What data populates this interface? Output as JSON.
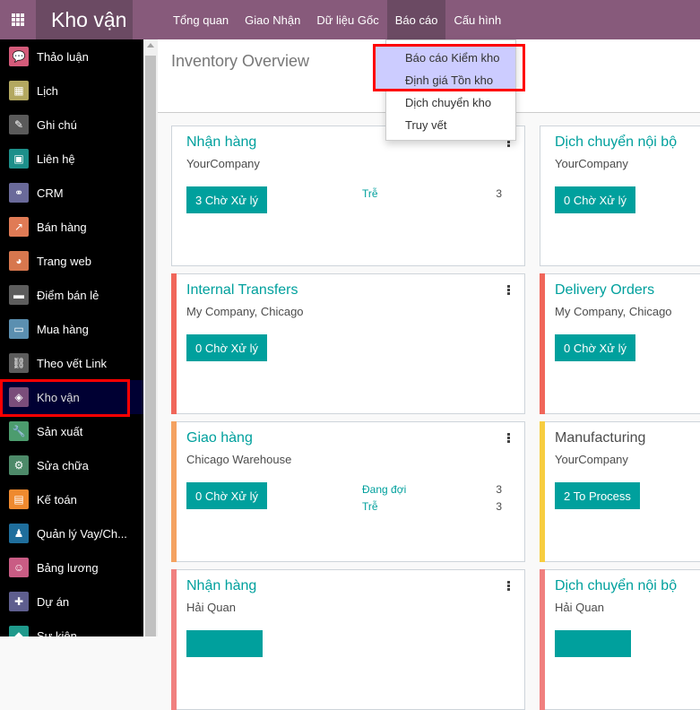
{
  "topbar": {
    "app_name": "Kho vận",
    "menu": [
      "Tổng quan",
      "Giao Nhận",
      "Dữ liệu Gốc",
      "Báo cáo",
      "Cấu hình"
    ],
    "active_menu": "Báo cáo"
  },
  "sidebar": {
    "items": [
      {
        "label": "Thảo luận",
        "icon": "chat-icon",
        "color": "#d45b7a",
        "glyph": "💬"
      },
      {
        "label": "Lịch",
        "icon": "calendar-icon",
        "color": "#b3a860",
        "glyph": "▦"
      },
      {
        "label": "Ghi chú",
        "icon": "note-icon",
        "color": "#5a5a5a",
        "glyph": "✎"
      },
      {
        "label": "Liên hệ",
        "icon": "contacts-icon",
        "color": "#1d8f8a",
        "glyph": "▣"
      },
      {
        "label": "CRM",
        "icon": "handshake-icon",
        "color": "#6a6a9a",
        "glyph": "⚭"
      },
      {
        "label": "Bán hàng",
        "icon": "sales-chart-icon",
        "color": "#e07b55",
        "glyph": "↗"
      },
      {
        "label": "Trang web",
        "icon": "globe-icon",
        "color": "#d7774e",
        "glyph": "◕"
      },
      {
        "label": "Điểm bán lẻ",
        "icon": "shop-icon",
        "color": "#5d5d5d",
        "glyph": "▬"
      },
      {
        "label": "Mua hàng",
        "icon": "credit-card-icon",
        "color": "#5b8fb0",
        "glyph": "▭"
      },
      {
        "label": "Theo vết Link",
        "icon": "link-icon",
        "color": "#5c5c5c",
        "glyph": "⛓"
      },
      {
        "label": "Kho vận",
        "icon": "box-icon",
        "color": "#7a4d7a",
        "glyph": "◈"
      },
      {
        "label": "Sản xuất",
        "icon": "wrench-icon",
        "color": "#4c9c6e",
        "glyph": "🔧"
      },
      {
        "label": "Sửa chữa",
        "icon": "repair-icon",
        "color": "#4d8a69",
        "glyph": "⚙"
      },
      {
        "label": "Kế toán",
        "icon": "accounting-icon",
        "color": "#ef8a2f",
        "glyph": "▤"
      },
      {
        "label": "Quản lý Vay/Ch...",
        "icon": "loan-icon",
        "color": "#1f6e9c",
        "glyph": "♟"
      },
      {
        "label": "Bảng lương",
        "icon": "payroll-icon",
        "color": "#c95c84",
        "glyph": "☺"
      },
      {
        "label": "Dự án",
        "icon": "puzzle-icon",
        "color": "#5e5e8e",
        "glyph": "✚"
      },
      {
        "label": "Sự kiện",
        "icon": "ticket-icon",
        "color": "#1f9a8c",
        "glyph": "◆"
      }
    ],
    "active_index": 10
  },
  "main": {
    "title": "Inventory Overview",
    "cards": [
      {
        "title": "Nhận hàng",
        "subtitle": "YourCompany",
        "button": "3 Chờ Xử lý",
        "bar_color": "",
        "title_dark": false,
        "kebab": true,
        "stats": [
          {
            "label": "Trễ",
            "value": "3"
          }
        ]
      },
      {
        "title": "Dịch chuyển nội bộ",
        "subtitle": "YourCompany",
        "button": "0 Chờ Xử lý",
        "bar_color": "",
        "title_dark": false,
        "kebab": false,
        "stats": []
      },
      {
        "title": "Internal Transfers",
        "subtitle": "My Company, Chicago",
        "button": "0 Chờ Xử lý",
        "bar_color": "#f0665a",
        "title_dark": false,
        "kebab": true,
        "stats": []
      },
      {
        "title": "Delivery Orders",
        "subtitle": "My Company, Chicago",
        "button": "0 Chờ Xử lý",
        "bar_color": "#f0665a",
        "title_dark": false,
        "kebab": false,
        "stats": []
      },
      {
        "title": "Giao hàng",
        "subtitle": "Chicago Warehouse",
        "button": "0 Chờ Xử lý",
        "bar_color": "#f4a261",
        "title_dark": false,
        "kebab": true,
        "stats": [
          {
            "label": "Đang đợi",
            "value": "3"
          },
          {
            "label": "Trễ",
            "value": "3"
          }
        ]
      },
      {
        "title": "Manufacturing",
        "subtitle": "YourCompany",
        "button": "2 To Process",
        "bar_color": "#f7cd40",
        "title_dark": true,
        "kebab": false,
        "stats": []
      },
      {
        "title": "Nhận hàng",
        "subtitle": "Hải Quan",
        "button": "",
        "bar_color": "#f0807f",
        "title_dark": false,
        "kebab": true,
        "stats": []
      },
      {
        "title": "Dịch chuyển nội bộ",
        "subtitle": "Hải Quan",
        "button": "",
        "bar_color": "#f0807f",
        "title_dark": false,
        "kebab": false,
        "stats": []
      }
    ]
  },
  "report_dropdown": {
    "items": [
      "Báo cáo Kiểm kho",
      "Định giá Tồn kho",
      "Dịch chuyển kho",
      "Truy vết"
    ],
    "highlighted": [
      "Báo cáo Kiểm kho",
      "Định giá Tồn kho"
    ]
  }
}
